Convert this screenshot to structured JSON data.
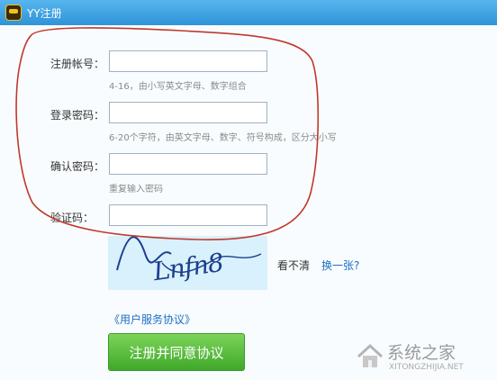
{
  "window": {
    "title": "YY注册"
  },
  "form": {
    "account_label": "注册帐号：",
    "account_hint": "4-16，由小写英文字母、数字组合",
    "password_label": "登录密码：",
    "password_hint": "6-20个字符，由英文字母、数字、符号构成，区分大小写",
    "confirm_label": "确认密码：",
    "confirm_hint": "重复输入密码",
    "captcha_label": "验证码：",
    "captcha_text": "Lnfn8",
    "unclear_text": "看不清",
    "refresh_link": "换一张?",
    "agreement_link": "《用户服务协议》",
    "submit_label": "注册并同意协议"
  },
  "watermark": {
    "text": "系统之家",
    "url": "XITONGZHIJIA.NET"
  },
  "annotation": {
    "color": "#c0392b"
  }
}
